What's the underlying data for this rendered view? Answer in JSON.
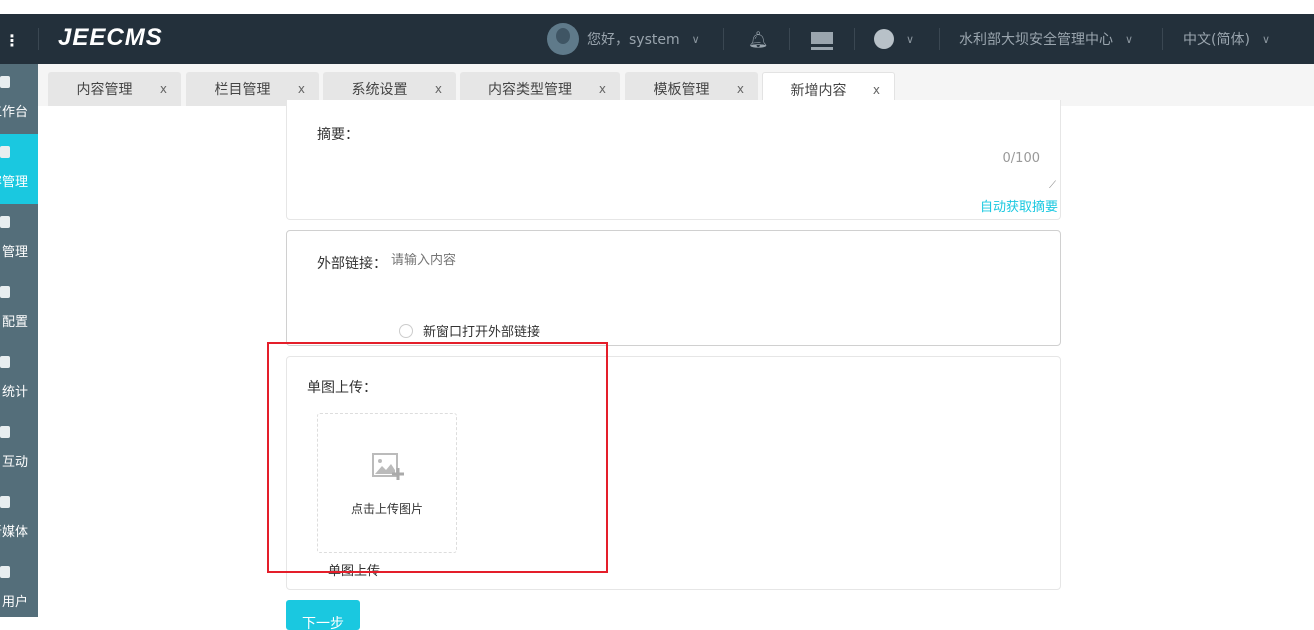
{
  "header": {
    "logo": "JEECMS",
    "greeting": "您好，system",
    "site": "水利部大坝安全管理中心",
    "language": "中文(简体)"
  },
  "sidebar": {
    "items": [
      {
        "label": "工作台"
      },
      {
        "label": "内容管理",
        "active": true
      },
      {
        "label": "栏目管理"
      },
      {
        "label": "配置"
      },
      {
        "label": "统计"
      },
      {
        "label": "互动"
      },
      {
        "label": "新媒体"
      },
      {
        "label": "用户"
      }
    ]
  },
  "tabs": [
    {
      "label": "内容管理"
    },
    {
      "label": "栏目管理"
    },
    {
      "label": "系统设置"
    },
    {
      "label": "内容类型管理"
    },
    {
      "label": "模板管理"
    },
    {
      "label": "新增内容",
      "active": true
    }
  ],
  "tab_close": "x",
  "form": {
    "summary_label": "摘要：",
    "summary_counter": "0/100",
    "auto_summary": "自动获取摘要",
    "external_link_label": "外部链接：",
    "external_link_placeholder": "请输入内容",
    "new_window_label": "新窗口打开外部链接",
    "single_image_label": "单图上传：",
    "upload_hint": "点击上传图片",
    "upload_caption": "单图上传",
    "next_button": "下一步"
  },
  "colors": {
    "accent": "#1ac8e0",
    "header": "#23303b",
    "sidebar": "#546e7a",
    "highlight": "#e41e2a"
  }
}
